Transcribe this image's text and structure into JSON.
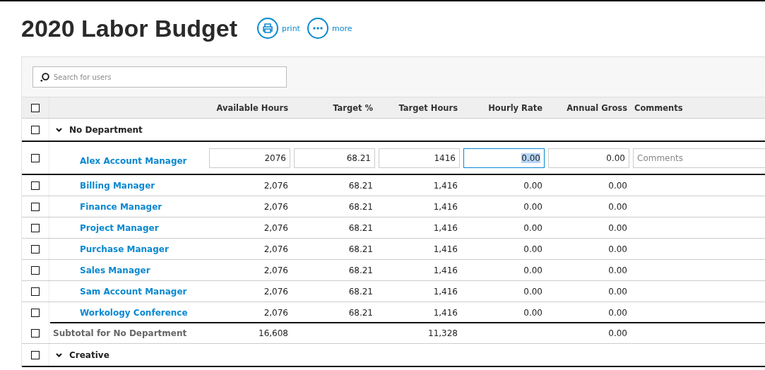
{
  "title": "2020 Labor Budget",
  "actions": [
    {
      "kind": "print",
      "label": "print"
    },
    {
      "kind": "more",
      "label": "more"
    }
  ],
  "search": {
    "placeholder": "Search for users"
  },
  "table": {
    "header_checked": false,
    "columns": [
      "Available Hours",
      "Target %",
      "Target Hours",
      "Hourly Rate",
      "Annual Gross",
      "Comments"
    ],
    "groups": [
      {
        "name": "No Department",
        "expanded": true,
        "checked": false,
        "rows": [
          {
            "kind": "editing",
            "name": "Alex Account Manager",
            "checked": false,
            "fields": [
              {
                "value": "2076",
                "focused": false
              },
              {
                "value": "68.21",
                "focused": false
              },
              {
                "value": "1416",
                "focused": false
              },
              {
                "value": "0.00",
                "focused": true
              },
              {
                "value": "0.00",
                "focused": false
              },
              {
                "placeholder": "Comments",
                "focused": false
              }
            ]
          },
          {
            "kind": "plain",
            "name": "Billing Manager",
            "checked": false,
            "cells": [
              "2,076",
              "68.21",
              "1,416",
              "0.00",
              "0.00"
            ]
          },
          {
            "kind": "plain",
            "name": "Finance Manager",
            "checked": false,
            "cells": [
              "2,076",
              "68.21",
              "1,416",
              "0.00",
              "0.00"
            ]
          },
          {
            "kind": "plain",
            "name": "Project Manager",
            "checked": false,
            "cells": [
              "2,076",
              "68.21",
              "1,416",
              "0.00",
              "0.00"
            ]
          },
          {
            "kind": "plain",
            "name": "Purchase Manager",
            "checked": false,
            "cells": [
              "2,076",
              "68.21",
              "1,416",
              "0.00",
              "0.00"
            ]
          },
          {
            "kind": "plain",
            "name": "Sales Manager",
            "checked": false,
            "cells": [
              "2,076",
              "68.21",
              "1,416",
              "0.00",
              "0.00"
            ]
          },
          {
            "kind": "plain",
            "name": "Sam Account Manager",
            "checked": false,
            "cells": [
              "2,076",
              "68.21",
              "1,416",
              "0.00",
              "0.00"
            ]
          },
          {
            "kind": "plain",
            "name": "Workology Conference",
            "checked": false,
            "cells": [
              "2,076",
              "68.21",
              "1,416",
              "0.00",
              "0.00"
            ]
          }
        ],
        "subtotal": {
          "label": "Subtotal for No Department",
          "checked": false,
          "cells": [
            "16,608",
            null,
            "11,328",
            null,
            "0.00"
          ]
        }
      },
      {
        "name": "Creative",
        "expanded": true,
        "checked": false
      }
    ]
  }
}
